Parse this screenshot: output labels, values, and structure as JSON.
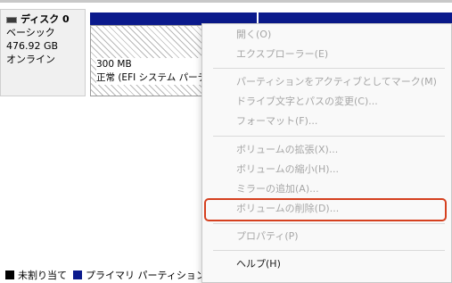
{
  "disk": {
    "title": "ディスク 0",
    "type": "ベーシック",
    "size": "476.92 GB",
    "status": "オンライン"
  },
  "partition": {
    "size": "300 MB",
    "status": "正常 (EFI システム パーティ"
  },
  "legend": {
    "unallocated": "未割り当て",
    "primary": "プライマリ パーティション"
  },
  "colors": {
    "primary_bar": "#0b1a8c",
    "highlight": "#d5401f",
    "disabled_text": "#a6a6a6"
  },
  "menu": {
    "open": "開く(O)",
    "explore": "エクスプローラー(E)",
    "mark_active": "パーティションをアクティブとしてマーク(M)",
    "change_letter": "ドライブ文字とパスの変更(C)...",
    "format": "フォーマット(F)...",
    "extend": "ボリュームの拡張(X)...",
    "shrink": "ボリュームの縮小(H)...",
    "add_mirror": "ミラーの追加(A)...",
    "delete_volume": "ボリュームの削除(D)...",
    "properties": "プロパティ(P)",
    "help": "ヘルプ(H)"
  }
}
